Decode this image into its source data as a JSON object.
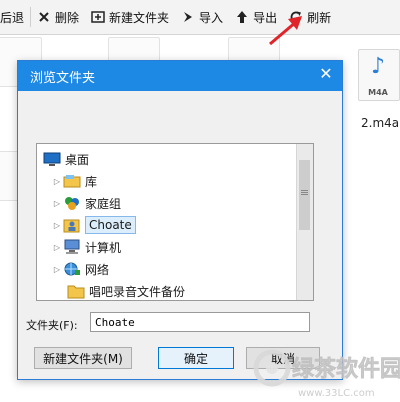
{
  "toolbar": {
    "items": [
      {
        "label": "后退"
      },
      {
        "label": "删除"
      },
      {
        "label": "新建文件夹"
      },
      {
        "label": "导入"
      },
      {
        "label": "导出"
      },
      {
        "label": "刷新"
      }
    ]
  },
  "files": {
    "m4a_tag": "M4A",
    "m4a_name": "2.m4a"
  },
  "dialog": {
    "title": "浏览文件夹",
    "tree": [
      {
        "label": "桌面"
      },
      {
        "label": "库"
      },
      {
        "label": "家庭组"
      },
      {
        "label": "Choate"
      },
      {
        "label": "计算机"
      },
      {
        "label": "网络"
      },
      {
        "label": "唱吧录音文件备份"
      }
    ],
    "folder_label": "文件夹(F):",
    "folder_value": "Choate",
    "new_folder": "新建文件夹(M)",
    "ok": "确定",
    "cancel": "取消"
  },
  "watermark": {
    "text": "绿茶软件园",
    "url": "www.33LC.com"
  },
  "colors": {
    "accent": "#1e88e5",
    "annotation": "#e0242a"
  }
}
